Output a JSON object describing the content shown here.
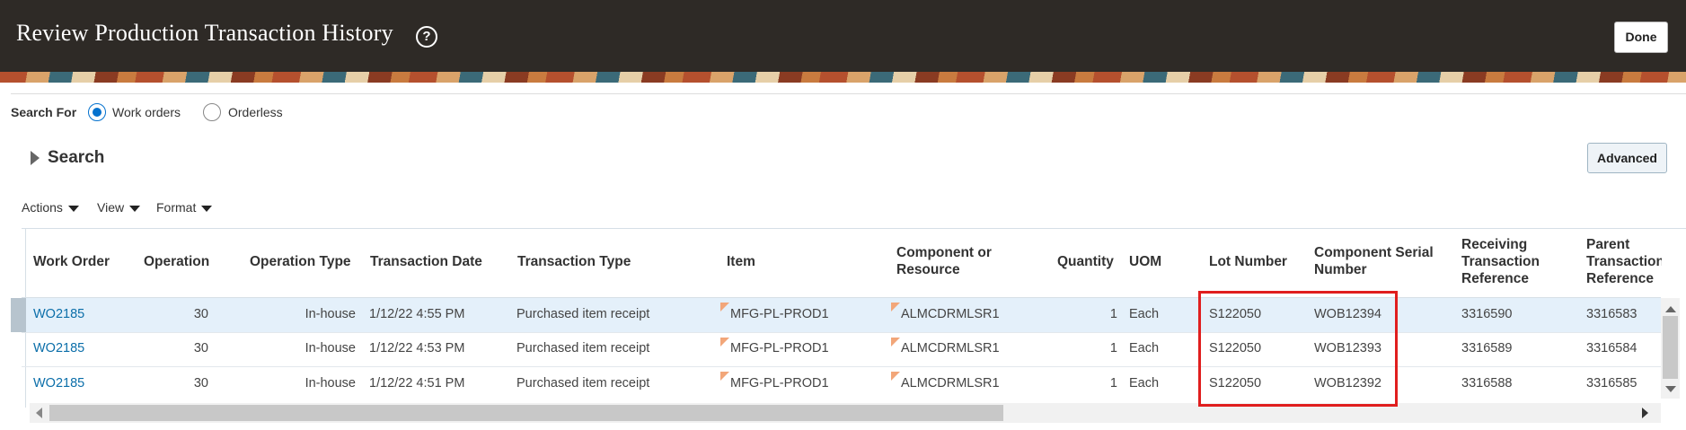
{
  "header": {
    "title": "Review Production Transaction History",
    "help_icon": "?",
    "done_label": "Done"
  },
  "search_for": {
    "label": "Search For",
    "options": [
      {
        "label": "Work orders",
        "selected": true
      },
      {
        "label": "Orderless",
        "selected": false
      }
    ]
  },
  "search_panel": {
    "title": "Search",
    "advanced_label": "Advanced"
  },
  "toolbar": {
    "actions_label": "Actions",
    "view_label": "View",
    "format_label": "Format"
  },
  "table": {
    "columns": [
      "Work Order",
      "Operation",
      "Operation Type",
      "Transaction Date",
      "Transaction Type",
      "Item",
      "Component or Resource",
      "Quantity",
      "UOM",
      "Lot Number",
      "Component Serial Number",
      "Receiving Transaction Reference",
      "Parent Transaction Reference"
    ],
    "rows": [
      {
        "work_order": "WO2185",
        "operation": "30",
        "operation_type": "In-house",
        "transaction_date": "1/12/22 4:55 PM",
        "transaction_type": "Purchased item receipt",
        "item": "MFG-PL-PROD1",
        "component": "ALMCDRMLSR1",
        "quantity": "1",
        "uom": "Each",
        "lot": "S122050",
        "serial": "WOB12394",
        "receiving_ref": "3316590",
        "parent_ref": "3316583"
      },
      {
        "work_order": "WO2185",
        "operation": "30",
        "operation_type": "In-house",
        "transaction_date": "1/12/22 4:53 PM",
        "transaction_type": "Purchased item receipt",
        "item": "MFG-PL-PROD1",
        "component": "ALMCDRMLSR1",
        "quantity": "1",
        "uom": "Each",
        "lot": "S122050",
        "serial": "WOB12393",
        "receiving_ref": "3316589",
        "parent_ref": "3316584"
      },
      {
        "work_order": "WO2185",
        "operation": "30",
        "operation_type": "In-house",
        "transaction_date": "1/12/22 4:51 PM",
        "transaction_type": "Purchased item receipt",
        "item": "MFG-PL-PROD1",
        "component": "ALMCDRMLSR1",
        "quantity": "1",
        "uom": "Each",
        "lot": "S122050",
        "serial": "WOB12392",
        "receiving_ref": "3316588",
        "parent_ref": "3316585"
      }
    ]
  },
  "colors": {
    "header_bg": "#2e2a26",
    "link": "#0b6ea9",
    "selected_row": "#e4f0fa",
    "highlight_box": "#e01e1e"
  }
}
